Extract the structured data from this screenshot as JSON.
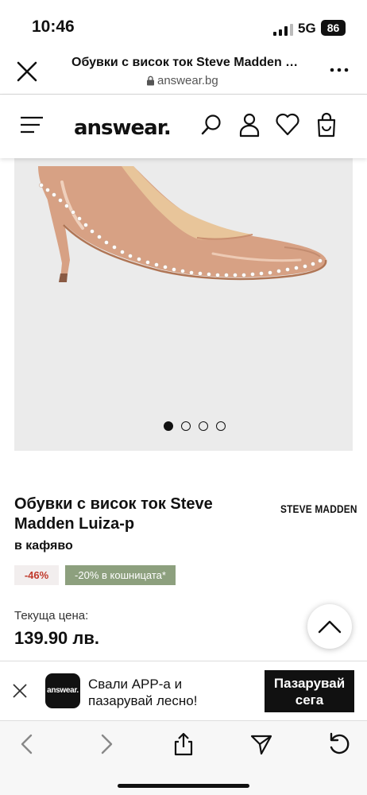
{
  "status_bar": {
    "time": "10:46",
    "network": "5G",
    "battery": "86"
  },
  "browser": {
    "page_title": "Обувки с висок ток Steve Madden Luiza-p в кафяво",
    "domain": "answear.bg"
  },
  "site": {
    "logo": "answear."
  },
  "gallery": {
    "slides": 4,
    "active_slide": 1
  },
  "product": {
    "name": "Обувки с висок ток Steve Madden Luiza-p",
    "brand": "STEVE MADDEN",
    "color": "в кафяво",
    "discount_badge": "-46%",
    "promo_badge": "-20% в кошницата*",
    "current_price_label": "Текуща цена:",
    "current_price": "139.90 лв."
  },
  "app_banner": {
    "logo_text": "answear.",
    "text": "Свали APP-а и пазарувай лесно!",
    "button": "Пазарувай сега"
  },
  "colors": {
    "promo_green": "#8da07e",
    "discount_red": "#c0392b",
    "gallery_bg": "#ebebeb",
    "shoe": "#d7a184"
  },
  "icons": [
    "close-icon",
    "lock-icon",
    "more-icon",
    "menu-icon",
    "search-icon",
    "account-icon",
    "heart-icon",
    "bag-icon",
    "chevron-up-icon",
    "back-icon",
    "forward-icon",
    "share-icon",
    "send-icon",
    "reload-icon"
  ]
}
